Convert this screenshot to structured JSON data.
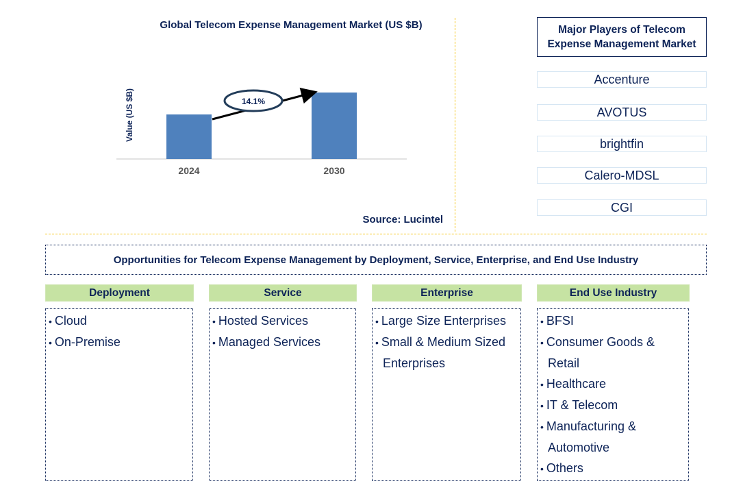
{
  "chart_data": {
    "type": "bar",
    "title": "Global Telecom Expense Management Market (US $B)",
    "xlabel": "",
    "ylabel": "Value (US $B)",
    "categories": [
      "2024",
      "2030"
    ],
    "values": [
      0.67,
      1.0
    ],
    "values_note": "relative heights; no axis ticks shown",
    "annotation": "14.1%",
    "grid": false,
    "bar_color": "#4f81bd"
  },
  "source": "Source: Lucintel",
  "players": {
    "title": "Major Players of Telecom Expense Management Market",
    "items": [
      "Accenture",
      "AVOTUS",
      "brightfin",
      "Calero-MDSL",
      "CGI"
    ]
  },
  "opportunities": {
    "title": "Opportunities for Telecom Expense Management by Deployment, Service, Enterprise, and End Use Industry",
    "categories": [
      {
        "name": "Deployment",
        "items": [
          "Cloud",
          "On-Premise"
        ]
      },
      {
        "name": "Service",
        "items": [
          "Hosted Services",
          "Managed Services"
        ]
      },
      {
        "name": "Enterprise",
        "items": [
          "Large Size Enterprises",
          "Small & Medium Sized Enterprises"
        ]
      },
      {
        "name": "End Use Industry",
        "items": [
          "BFSI",
          "Consumer Goods & Retail",
          "Healthcare",
          "IT & Telecom",
          "Manufacturing & Automotive",
          "Others"
        ]
      }
    ]
  },
  "colors": {
    "navy": "#0d2357",
    "bar": "#4f81bd",
    "divider": "#f5c518",
    "header_green": "#c6e3a3"
  }
}
